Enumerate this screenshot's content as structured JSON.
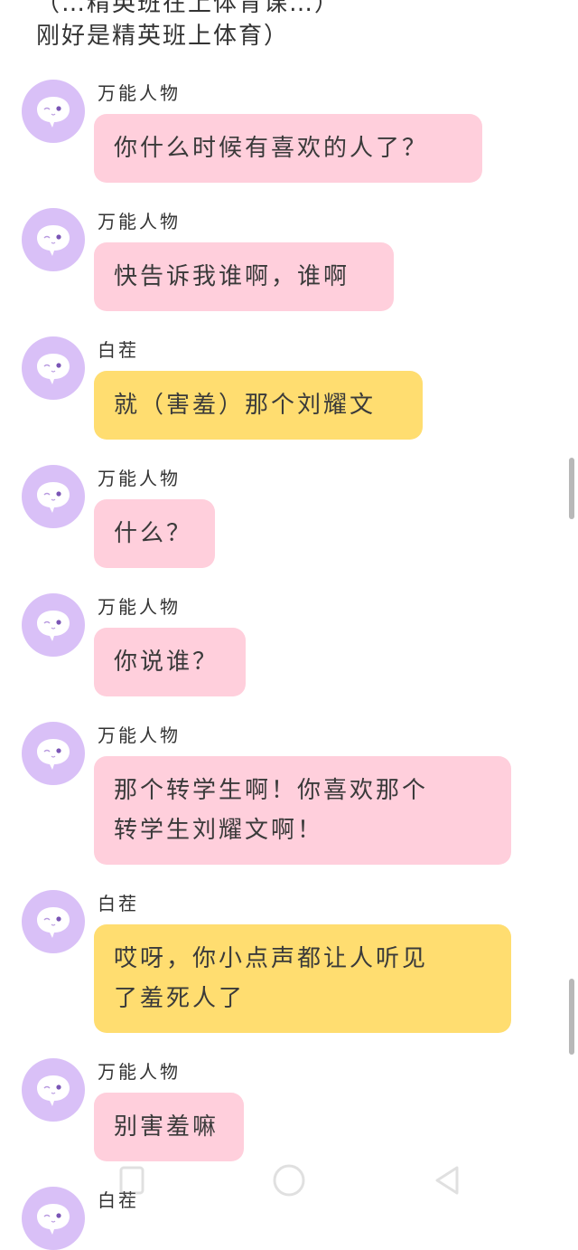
{
  "top_text": {
    "line1": "（…精英班在上体育课…）",
    "line2": "刚好是精英班上体育）"
  },
  "colors": {
    "avatar": "#d9c0f7",
    "pink_bubble": "#ffcfdc",
    "yellow_bubble": "#ffdd70"
  },
  "messages": [
    {
      "name": "万能人物",
      "lines": [
        "你什么时候有喜欢的人了？"
      ],
      "color": "pink"
    },
    {
      "name": "万能人物",
      "lines": [
        "快告诉我谁啊，谁啊"
      ],
      "color": "pink"
    },
    {
      "name": "白茬",
      "lines": [
        "就（害羞）那个刘耀文"
      ],
      "color": "yellow"
    },
    {
      "name": "万能人物",
      "lines": [
        "什么？"
      ],
      "color": "pink"
    },
    {
      "name": "万能人物",
      "lines": [
        "你说谁？"
      ],
      "color": "pink"
    },
    {
      "name": "万能人物",
      "lines": [
        "那个转学生啊！你喜欢那个",
        "转学生刘耀文啊！"
      ],
      "color": "pink"
    },
    {
      "name": "白茬",
      "lines": [
        "哎呀，你小点声都让人听见",
        "了羞死人了"
      ],
      "color": "yellow"
    },
    {
      "name": "万能人物",
      "lines": [
        "别害羞嘛"
      ],
      "color": "pink"
    },
    {
      "name": "白茬",
      "lines": [],
      "color": "yellow"
    }
  ],
  "icons": {
    "avatar": "chat-bubble-face-icon",
    "nav_recent": "square-icon",
    "nav_home": "circle-icon",
    "nav_back": "triangle-back-icon"
  }
}
